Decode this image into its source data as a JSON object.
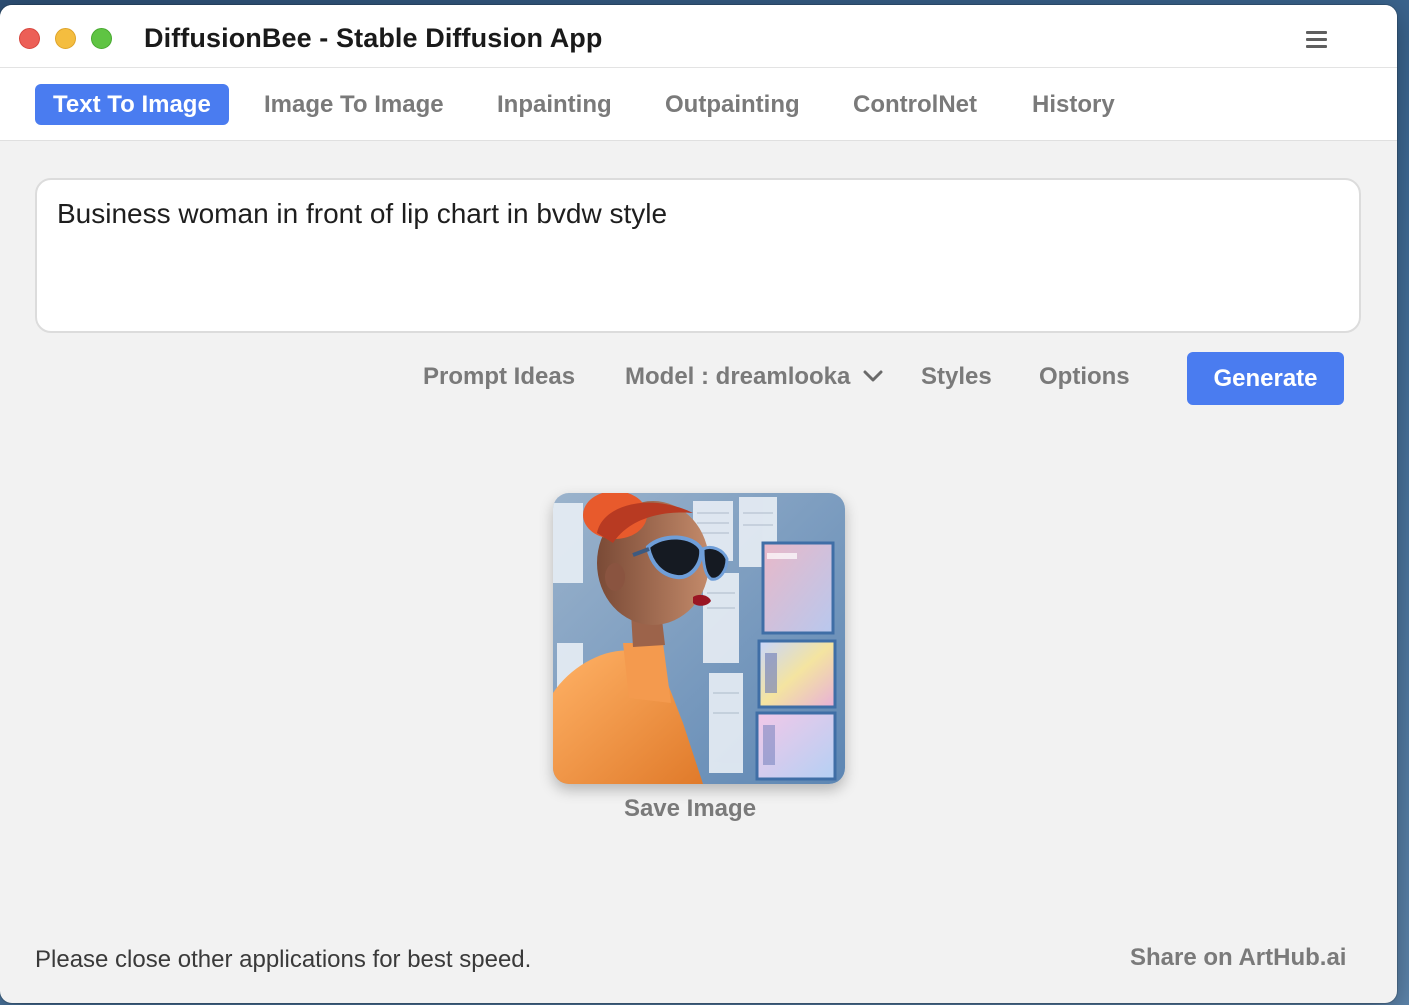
{
  "window": {
    "title": "DiffusionBee - Stable Diffusion App"
  },
  "tabs": [
    {
      "label": "Text To Image",
      "active": true
    },
    {
      "label": "Image To Image",
      "active": false
    },
    {
      "label": "Inpainting",
      "active": false
    },
    {
      "label": "Outpainting",
      "active": false
    },
    {
      "label": "ControlNet",
      "active": false
    },
    {
      "label": "History",
      "active": false
    }
  ],
  "prompt": {
    "value": "Business woman in front of lip chart in bvdw style"
  },
  "toolbar": {
    "prompt_ideas": "Prompt Ideas",
    "model_label": "Model : dreamlooka",
    "styles": "Styles",
    "options": "Options",
    "generate": "Generate"
  },
  "result": {
    "save_label": "Save Image"
  },
  "footer": {
    "status": "Please close other applications for best speed.",
    "share": "Share on ArtHub.ai"
  },
  "colors": {
    "accent": "#4a7cf0",
    "muted_text": "#7a7a7a",
    "window_bg": "#f2f2f2"
  },
  "icons": {
    "menu": "hamburger-menu-icon",
    "model_dropdown": "chevron-down-icon"
  }
}
